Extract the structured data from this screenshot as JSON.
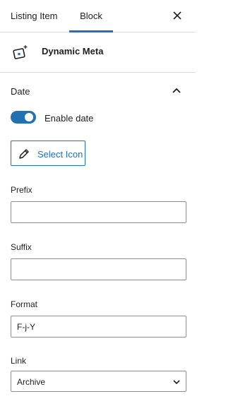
{
  "tabs": [
    {
      "label": "Listing Item",
      "active": false
    },
    {
      "label": "Block",
      "active": true
    }
  ],
  "header": {
    "close_icon": "close-icon"
  },
  "block": {
    "title": "Dynamic Meta",
    "icon": "meta-tag-icon"
  },
  "panel": {
    "title": "Date",
    "expanded": true,
    "enable_date": {
      "label": "Enable date",
      "checked": true
    },
    "select_icon": {
      "label": "Select Icon",
      "icon": "pencil-icon"
    },
    "prefix": {
      "label": "Prefix",
      "value": ""
    },
    "suffix": {
      "label": "Suffix",
      "value": ""
    },
    "format": {
      "label": "Format",
      "value": "F-j-Y"
    },
    "link": {
      "label": "Link",
      "selected": "Archive"
    }
  },
  "colors": {
    "accent": "#2271b1",
    "border": "#e0e0e0",
    "input_border": "#8c8f94"
  }
}
